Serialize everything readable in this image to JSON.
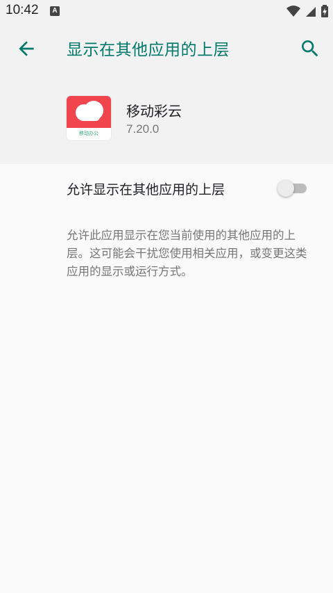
{
  "status_bar": {
    "time": "10:42",
    "notification_icon": "A"
  },
  "app_bar": {
    "title": "显示在其他应用的上层",
    "back_icon": "arrow-back",
    "search_icon": "search"
  },
  "app": {
    "name": "移动彩云",
    "version": "7.20.0",
    "icon_label": "移动办公"
  },
  "permission": {
    "toggle_label": "允许显示在其他应用的上层",
    "enabled": false,
    "description": "允许此应用显示在您当前使用的其他应用的上层。这可能会干扰您使用相关应用，或变更这类应用的显示或运行方式。"
  },
  "colors": {
    "accent": "#00796b",
    "app_icon_red": "#f0454c"
  }
}
